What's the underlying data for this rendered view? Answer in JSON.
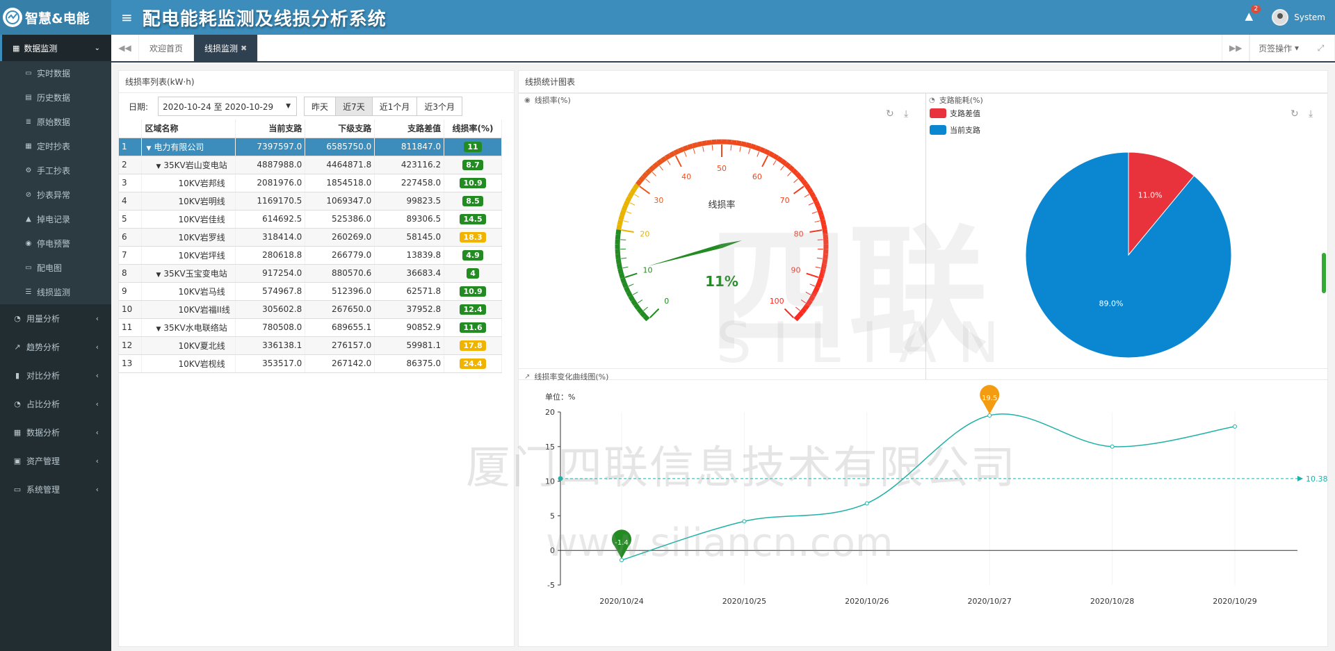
{
  "brand": {
    "name": "智慧&电能"
  },
  "header": {
    "title": "配电能耗监测及线损分析系统",
    "alert_count": "2",
    "user": "System"
  },
  "sidebar": {
    "active": "数据监测",
    "submenu": [
      {
        "label": "实时数据",
        "icon": "monitor-icon"
      },
      {
        "label": "历史数据",
        "icon": "book-icon"
      },
      {
        "label": "原始数据",
        "icon": "database-icon"
      },
      {
        "label": "定时抄表",
        "icon": "table-icon"
      },
      {
        "label": "手工抄表",
        "icon": "gears-icon"
      },
      {
        "label": "抄表异常",
        "icon": "ban-icon"
      },
      {
        "label": "掉电记录",
        "icon": "warning-icon"
      },
      {
        "label": "停电预警",
        "icon": "dot-circle-icon"
      },
      {
        "label": "配电图",
        "icon": "desktop-icon"
      },
      {
        "label": "线损监测",
        "icon": "sliders-icon"
      }
    ],
    "menus": [
      {
        "label": "用量分析",
        "icon": "pie-icon"
      },
      {
        "label": "趋势分析",
        "icon": "line-chart-icon"
      },
      {
        "label": "对比分析",
        "icon": "bar-chart-icon"
      },
      {
        "label": "占比分析",
        "icon": "pie-icon"
      },
      {
        "label": "数据分析",
        "icon": "sitemap-icon"
      },
      {
        "label": "资产管理",
        "icon": "money-icon"
      },
      {
        "label": "系统管理",
        "icon": "desktop-icon"
      }
    ]
  },
  "tabs": {
    "items": [
      "欢迎首页",
      "线损监测"
    ],
    "page_ops": "页签操作"
  },
  "table_panel": {
    "title": "线损率列表(kW·h)",
    "date_label": "日期:",
    "date_value": "2020-10-24 至 2020-10-29",
    "ranges": [
      "昨天",
      "近7天",
      "近1个月",
      "近3个月"
    ],
    "active_range": "近7天",
    "columns": [
      "区域名称",
      "当前支路",
      "下级支路",
      "支路差值",
      "线损率(%)"
    ],
    "rows": [
      {
        "no": "1",
        "name": "电力有限公司",
        "indent": 0,
        "caret": true,
        "cur": "7397597.0",
        "sub": "6585750.0",
        "diff": "811847.0",
        "rate": "11",
        "color": "#228b22"
      },
      {
        "no": "2",
        "name": "35KV岩山变电站",
        "indent": 1,
        "caret": true,
        "cur": "4887988.0",
        "sub": "4464871.8",
        "diff": "423116.2",
        "rate": "8.7",
        "color": "#228b22"
      },
      {
        "no": "3",
        "name": "10KV岩邦线",
        "indent": 2,
        "caret": false,
        "cur": "2081976.0",
        "sub": "1854518.0",
        "diff": "227458.0",
        "rate": "10.9",
        "color": "#228b22"
      },
      {
        "no": "4",
        "name": "10KV岩明线",
        "indent": 2,
        "caret": false,
        "cur": "1169170.5",
        "sub": "1069347.0",
        "diff": "99823.5",
        "rate": "8.5",
        "color": "#228b22"
      },
      {
        "no": "5",
        "name": "10KV岩佳线",
        "indent": 2,
        "caret": false,
        "cur": "614692.5",
        "sub": "525386.0",
        "diff": "89306.5",
        "rate": "14.5",
        "color": "#228b22"
      },
      {
        "no": "6",
        "name": "10KV岩罗线",
        "indent": 2,
        "caret": false,
        "cur": "318414.0",
        "sub": "260269.0",
        "diff": "58145.0",
        "rate": "18.3",
        "color": "#f0b400"
      },
      {
        "no": "7",
        "name": "10KV岩坪线",
        "indent": 2,
        "caret": false,
        "cur": "280618.8",
        "sub": "266779.0",
        "diff": "13839.8",
        "rate": "4.9",
        "color": "#228b22"
      },
      {
        "no": "8",
        "name": "35KV玉宝变电站",
        "indent": 1,
        "caret": true,
        "cur": "917254.0",
        "sub": "880570.6",
        "diff": "36683.4",
        "rate": "4",
        "color": "#228b22"
      },
      {
        "no": "9",
        "name": "10KV岩马线",
        "indent": 2,
        "caret": false,
        "cur": "574967.8",
        "sub": "512396.0",
        "diff": "62571.8",
        "rate": "10.9",
        "color": "#228b22"
      },
      {
        "no": "10",
        "name": "10KV岩福II线",
        "indent": 2,
        "caret": false,
        "cur": "305602.8",
        "sub": "267650.0",
        "diff": "37952.8",
        "rate": "12.4",
        "color": "#228b22"
      },
      {
        "no": "11",
        "name": "35KV水电联络站",
        "indent": 1,
        "caret": true,
        "cur": "780508.0",
        "sub": "689655.1",
        "diff": "90852.9",
        "rate": "11.6",
        "color": "#228b22"
      },
      {
        "no": "12",
        "name": "10KV夏北线",
        "indent": 2,
        "caret": false,
        "cur": "336138.1",
        "sub": "276157.0",
        "diff": "59981.1",
        "rate": "17.8",
        "color": "#f0b400"
      },
      {
        "no": "13",
        "name": "10KV岩枧线",
        "indent": 2,
        "caret": false,
        "cur": "353517.0",
        "sub": "267142.0",
        "diff": "86375.0",
        "rate": "24.4",
        "color": "#f0b400"
      }
    ]
  },
  "chart_panel": {
    "title": "线损统计图表",
    "gauge_title": "线损率(%)",
    "pie_title": "支路能耗(%)",
    "line_title": "线损率变化曲线图(%)"
  },
  "chart_data": [
    {
      "type": "gauge",
      "name": "线损率",
      "value": 11,
      "display": "11%",
      "min": 0,
      "max": 100,
      "ticks": [
        "0",
        "10",
        "20",
        "30",
        "40",
        "50",
        "60",
        "70",
        "80",
        "90",
        "100"
      ]
    },
    {
      "type": "pie",
      "series": [
        {
          "name": "支路差值",
          "value": 11.0,
          "color": "#e8323c"
        },
        {
          "name": "当前支路",
          "value": 89.0,
          "color": "#0a87d0"
        }
      ],
      "labels": [
        "11.0%",
        "89.0%"
      ]
    },
    {
      "type": "line",
      "unit_label": "单位：%",
      "x": [
        "2020/10/24",
        "2020/10/25",
        "2020/10/26",
        "2020/10/27",
        "2020/10/28",
        "2020/10/29"
      ],
      "y": [
        -1.4,
        4.2,
        6.8,
        19.5,
        15.0,
        17.9
      ],
      "ylim": [
        -5,
        20
      ],
      "yticks": [
        "-5",
        "0",
        "5",
        "10",
        "15",
        "20"
      ],
      "max_label": "19.5",
      "min_label": "-1.4",
      "avg_label": "10.38",
      "avg": 10.38,
      "color": "#1fb1a7"
    }
  ],
  "watermark": {
    "cn": "厦门四联信息技术有限公司",
    "url": "www.siliancn.com",
    "big": "四联",
    "en": "SILIAN"
  }
}
